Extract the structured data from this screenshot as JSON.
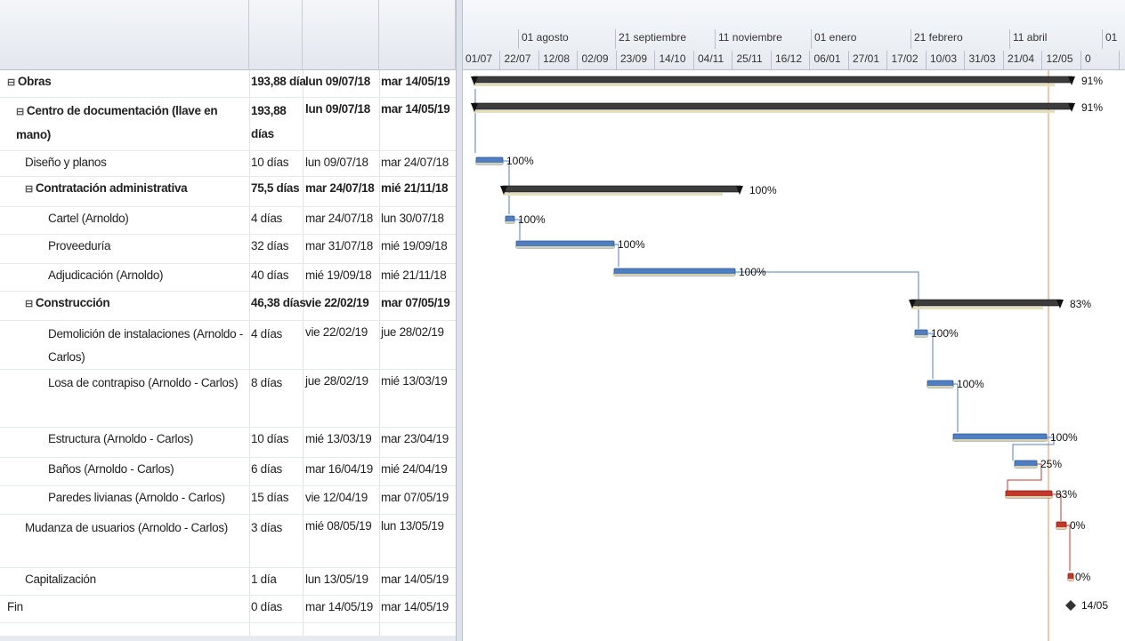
{
  "columns": [
    {
      "key": "name",
      "label": ""
    },
    {
      "key": "duration",
      "label": ""
    },
    {
      "key": "start",
      "label": ""
    },
    {
      "key": "finish",
      "label": ""
    }
  ],
  "timescale": {
    "top": [
      "01 agosto",
      "21 septiembre",
      "11 noviembre",
      "01 enero",
      "21 febrero",
      "11 abril",
      "01"
    ],
    "bottom": [
      "01/07",
      "22/07",
      "12/08",
      "02/09",
      "23/09",
      "14/10",
      "04/11",
      "25/11",
      "16/12",
      "06/01",
      "27/01",
      "17/02",
      "10/03",
      "31/03",
      "21/04",
      "12/05",
      "0"
    ]
  },
  "tasks": [
    {
      "name": "Obras",
      "duration": "193,88 día",
      "start": "lun 09/07/18",
      "finish": "mar 14/05/19",
      "summary": true,
      "level": 0,
      "pct": "91%"
    },
    {
      "name": "Centro de documentación (llave en mano)",
      "duration": "193,88 días",
      "start": "lun 09/07/18",
      "finish": "mar 14/05/19",
      "summary": true,
      "level": 1,
      "pct": "91%"
    },
    {
      "name": "Diseño y planos",
      "duration": "10 días",
      "start": "lun 09/07/18",
      "finish": "mar 24/07/18",
      "summary": false,
      "level": 2,
      "pct": "100%"
    },
    {
      "name": "Contratación administrativa",
      "duration": "75,5 días",
      "start": "mar 24/07/18",
      "finish": "mié 21/11/18",
      "summary": true,
      "level": 2,
      "pct": "100%"
    },
    {
      "name": "Cartel (Arnoldo)",
      "duration": "4 días",
      "start": "mar 24/07/18",
      "finish": "lun 30/07/18",
      "summary": false,
      "level": 3,
      "pct": "100%"
    },
    {
      "name": "Proveeduría",
      "duration": "32 días",
      "start": "mar 31/07/18",
      "finish": "mié 19/09/18",
      "summary": false,
      "level": 3,
      "pct": "100%"
    },
    {
      "name": "Adjudicación (Arnoldo)",
      "duration": "40 días",
      "start": "mié 19/09/18",
      "finish": "mié 21/11/18",
      "summary": false,
      "level": 3,
      "pct": "100%"
    },
    {
      "name": "Construcción",
      "duration": "46,38 días",
      "start": "vie 22/02/19",
      "finish": "mar 07/05/19",
      "summary": true,
      "level": 2,
      "pct": "83%"
    },
    {
      "name": "Demolición de instalaciones (Arnoldo - Carlos)",
      "duration": "4 días",
      "start": "vie 22/02/19",
      "finish": "jue 28/02/19",
      "summary": false,
      "level": 3,
      "pct": "100%"
    },
    {
      "name": "Losa de contrapiso (Arnoldo - Carlos)",
      "duration": "8 días",
      "start": "jue 28/02/19",
      "finish": "mié 13/03/19",
      "summary": false,
      "level": 3,
      "pct": "100%"
    },
    {
      "name": "Estructura (Arnoldo - Carlos)",
      "duration": "10 días",
      "start": "mié 13/03/19",
      "finish": "mar 23/04/19",
      "summary": false,
      "level": 3,
      "pct": "100%"
    },
    {
      "name": "Baños (Arnoldo - Carlos)",
      "duration": "6 días",
      "start": "mar 16/04/19",
      "finish": "mié 24/04/19",
      "summary": false,
      "level": 3,
      "pct": "25%"
    },
    {
      "name": "Paredes livianas (Arnoldo - Carlos)",
      "duration": "15 días",
      "start": "vie 12/04/19",
      "finish": "mar 07/05/19",
      "summary": false,
      "level": 3,
      "pct": "83%"
    },
    {
      "name": "Mudanza de usuarios (Arnoldo - Carlos)",
      "duration": "3 días",
      "start": "mié 08/05/19",
      "finish": "lun 13/05/19",
      "summary": false,
      "level": 2,
      "pct": "0%"
    },
    {
      "name": "Capitalización",
      "duration": "1 día",
      "start": "lun 13/05/19",
      "finish": "mar 14/05/19",
      "summary": false,
      "level": 2,
      "pct": "0%"
    },
    {
      "name": "Fin",
      "duration": "0 días",
      "start": "mar 14/05/19",
      "finish": "mar 14/05/19",
      "summary": false,
      "level": 0,
      "pct": "14/05",
      "milestone": true
    }
  ],
  "colors": {
    "summary_bar": "#3c3c3c",
    "task_bar": "#4f7fc0",
    "critical_bar": "#c0392b",
    "baseline": "#e4dfb8",
    "link": "#4f7fc0",
    "today_line": "#f0a070"
  },
  "icons": {
    "collapse": "minus-box-icon",
    "milestone": "diamond-icon"
  }
}
